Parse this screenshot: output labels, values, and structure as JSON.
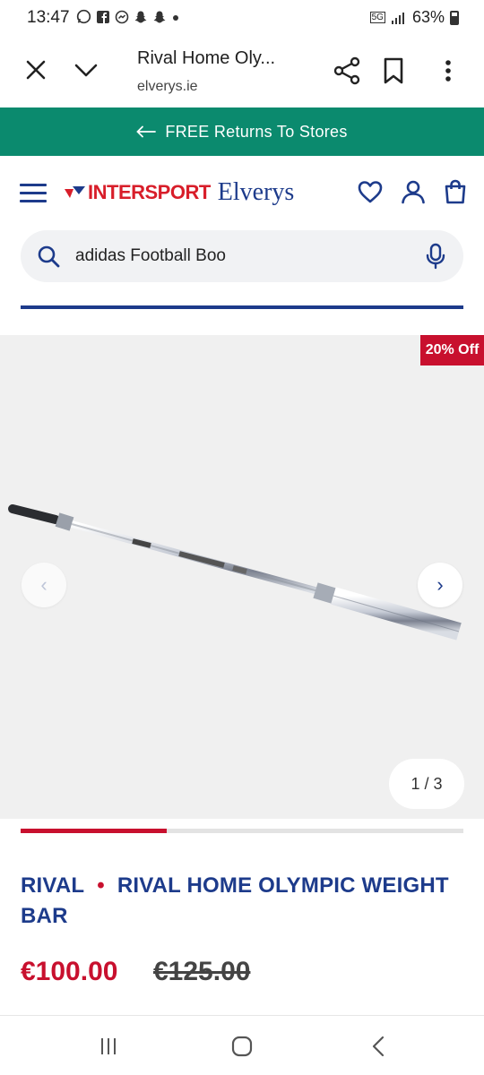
{
  "status_bar": {
    "time": "13:47",
    "notification_icons": [
      "whatsapp-icon",
      "facebook-icon",
      "messenger-icon",
      "snapchat-icon",
      "snapchat-icon",
      "dot-icon"
    ],
    "network": "5G",
    "battery": "63%"
  },
  "browser": {
    "page_title": "Rival Home Oly...",
    "domain": "elverys.ie"
  },
  "promo": {
    "text": "FREE Returns To Stores"
  },
  "site": {
    "brand_primary": "INTERSPORT",
    "brand_secondary": "Elverys",
    "accent_color": "#1d3b8b",
    "sale_color": "#c8102e"
  },
  "search": {
    "value": "adidas Football Boo"
  },
  "gallery": {
    "badge": "20% Off",
    "counter": "1 / 3",
    "prev_label": "‹",
    "next_label": "›",
    "progress_fraction": 0.33
  },
  "product": {
    "brand": "RIVAL",
    "separator": "•",
    "name": "RIVAL HOME OLYMPIC WEIGHT BAR",
    "price_now": "€100.00",
    "price_was": "€125.00"
  }
}
